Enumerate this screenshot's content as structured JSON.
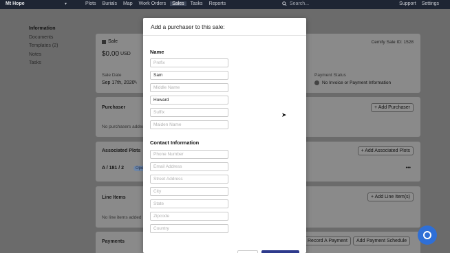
{
  "topnav": {
    "brand": "Mt Hope",
    "links": [
      "Plots",
      "Burials",
      "Map",
      "Work Orders",
      "Sales",
      "Tasks",
      "Reports"
    ],
    "active": "Sales",
    "search_placeholder": "Search...",
    "right": [
      "Support",
      "Settings"
    ]
  },
  "sidenav": [
    "Information",
    "Documents",
    "Templates (2)",
    "Notes",
    "Tasks"
  ],
  "sale": {
    "label": "Sale",
    "amount": "$0.00",
    "currency": "USD",
    "sale_id": "Cemify Sale ID: 1528",
    "sale_date_label": "Sale Date",
    "sale_date": "Sep 17th, 2020",
    "payment_status_label": "Payment Status",
    "payment_status": "No Invoice or Payment Information"
  },
  "purchaser": {
    "title": "Purchaser",
    "button": "+ Add Purchaser",
    "empty": "No purchasers added"
  },
  "plots": {
    "title": "Associated Plots",
    "button": "+ Add Associated Plots",
    "row": "A / 181 / 2",
    "badge": "Ope",
    "more": "•••"
  },
  "line_items": {
    "title": "Line Items",
    "button": "+ Add Line Item(s)",
    "empty": "No line items added"
  },
  "payments": {
    "title": "Payments",
    "record": "Record A Payment",
    "schedule": "Add Payment Schedule"
  },
  "modal": {
    "title": "Add a purchaser to this sale:",
    "name_section": "Name",
    "name_fields": [
      {
        "placeholder": "Prefix",
        "value": ""
      },
      {
        "placeholder": "First Name",
        "value": "Sam"
      },
      {
        "placeholder": "Middle Name",
        "value": ""
      },
      {
        "placeholder": "Last Name",
        "value": "Howard"
      },
      {
        "placeholder": "Suffix",
        "value": ""
      },
      {
        "placeholder": "Maiden Name",
        "value": ""
      }
    ],
    "contact_section": "Contact Information",
    "contact_fields": [
      {
        "placeholder": "Phone Number",
        "value": ""
      },
      {
        "placeholder": "Email Address",
        "value": ""
      },
      {
        "placeholder": "Street Address",
        "value": ""
      },
      {
        "placeholder": "City",
        "value": ""
      },
      {
        "placeholder": "State",
        "value": ""
      },
      {
        "placeholder": "Zipcode",
        "value": ""
      },
      {
        "placeholder": "Country",
        "value": ""
      }
    ]
  },
  "icons": [
    "chevron-down-icon",
    "search-icon",
    "pencil-icon",
    "mouse-cursor-icon",
    "chat-icon",
    "sale-icon"
  ]
}
